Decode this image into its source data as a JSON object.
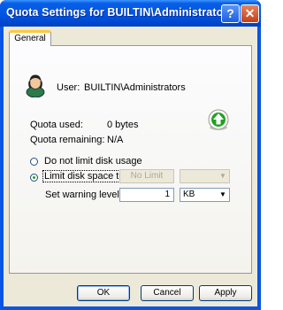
{
  "window": {
    "title": "Quota Settings for BUILTIN\\Administrators",
    "help_glyph": "?",
    "close_glyph": "✕"
  },
  "tabs": [
    {
      "label": "General",
      "selected": true
    }
  ],
  "user": {
    "label": "User:",
    "name": "BUILTIN\\Administrators",
    "icon": "user-icon"
  },
  "quota": {
    "used_label": "Quota used:",
    "used_value": "0 bytes",
    "remaining_label": "Quota remaining:",
    "remaining_value": "N/A",
    "status_icon": "up-arrow-icon"
  },
  "options": {
    "no_limit_label": "Do not limit disk usage",
    "limit_label": "Limit disk space to",
    "limit_value": "No Limit",
    "limit_unit": "",
    "limit_selected": true,
    "warning_label": "Set warning level to",
    "warning_value": "1",
    "warning_unit": "KB"
  },
  "buttons": {
    "ok": "OK",
    "cancel": "Cancel",
    "apply": "Apply"
  },
  "colors": {
    "titlebar": "#0054e3",
    "dialog_bg": "#ece9d8",
    "up_arrow": "#21a121"
  }
}
